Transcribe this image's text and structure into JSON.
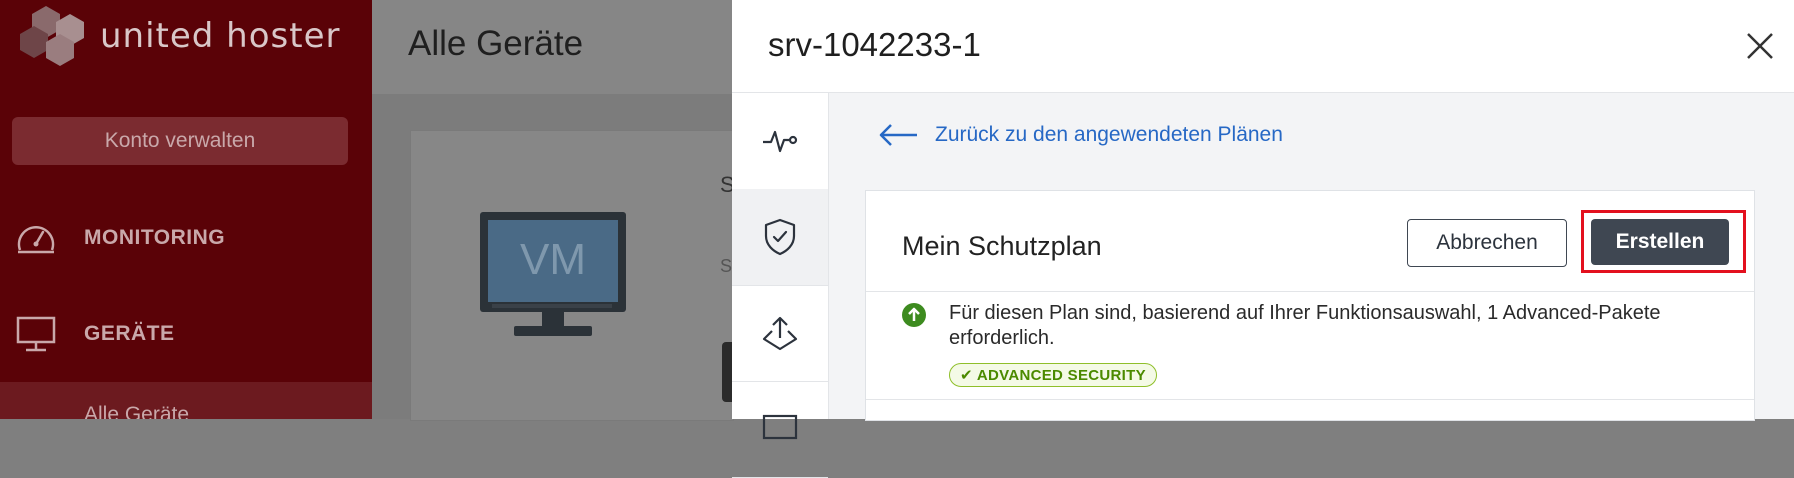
{
  "app": {
    "brand": "united hoster"
  },
  "sidebar": {
    "manage_label": "Konto verwalten",
    "items": [
      {
        "label": "MONITORING",
        "icon": "speedometer-icon"
      },
      {
        "label": "GERÄTE",
        "icon": "monitor-icon"
      }
    ],
    "sub_item": "Alle Geräte"
  },
  "main": {
    "title": "Alle Geräte",
    "card_letter": "S",
    "card_letter2": "S",
    "vm_label": "VM"
  },
  "panel": {
    "title": "srv-1042233-1",
    "tabs": [
      {
        "name": "activity-icon"
      },
      {
        "name": "shield-check-icon"
      },
      {
        "name": "upload-icon"
      },
      {
        "name": "monitor-icon"
      }
    ],
    "back_link": "Zurück zu den angewendeten Plänen",
    "plan": {
      "title": "Mein Schutzplan",
      "cancel_label": "Abbrechen",
      "create_label": "Erstellen",
      "info_text": "Für diesen Plan sind, basierend auf Ihrer Funktionsauswahl, 1 Advanced-Pakete erforderlich.",
      "badge": "ADVANCED SECURITY"
    }
  },
  "colors": {
    "accent_blue": "#2668c5",
    "primary_button": "#3f4752",
    "highlight_red": "#e3101e",
    "badge_green": "#4b8a00"
  }
}
